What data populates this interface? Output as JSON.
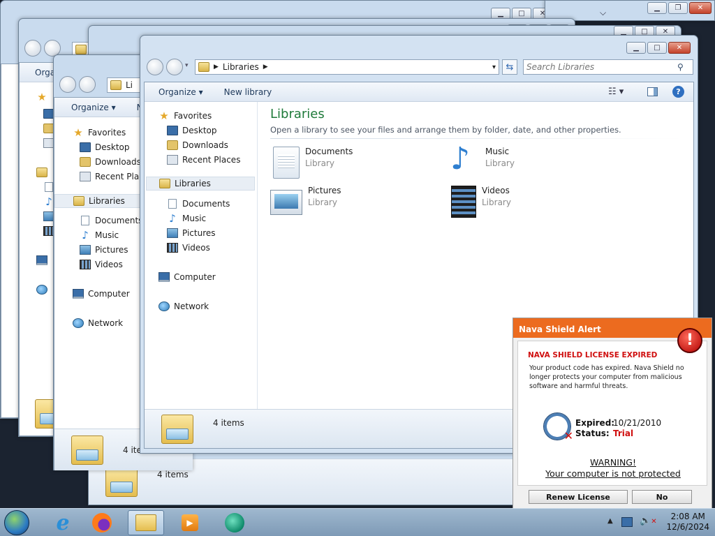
{
  "colors": {
    "accent_green": "#1f7a3a",
    "alert_orange": "#ec6b1f",
    "alert_red": "#d01010"
  },
  "explorer": {
    "breadcrumb": "Libraries",
    "search_placeholder": "Search Libraries",
    "toolbar": {
      "organize": "Organize ▾",
      "new_library": "New library"
    },
    "nav": {
      "favorites": "Favorites",
      "desktop": "Desktop",
      "downloads": "Downloads",
      "recent_places": "Recent Places",
      "libraries": "Libraries",
      "documents": "Documents",
      "music": "Music",
      "pictures": "Pictures",
      "videos": "Videos",
      "computer": "Computer",
      "network": "Network"
    },
    "main": {
      "title": "Libraries",
      "subtitle": "Open a library to see your files and arrange them by folder, date, and other properties.",
      "tiles": [
        {
          "name": "Documents",
          "type": "Library",
          "icon": "documents-library-icon"
        },
        {
          "name": "Music",
          "type": "Library",
          "icon": "music-library-icon"
        },
        {
          "name": "Pictures",
          "type": "Library",
          "icon": "pictures-library-icon"
        },
        {
          "name": "Videos",
          "type": "Library",
          "icon": "videos-library-icon"
        }
      ]
    },
    "status": "4 items",
    "back_window": {
      "breadcrumb_short": "Li",
      "organize_short": "N",
      "recent_short": "Recent Place"
    }
  },
  "alert": {
    "title": "Nava Shield Alert",
    "headline": "NAVA SHIELD LICENSE EXPIRED",
    "message": "Your product code has expired. Nava Shield no longer protects your computer from malicious software and harmful threats.",
    "expired_label": "Expired:",
    "expired_value": "10/21/2010",
    "status_label": "Status:",
    "status_value": "Trial",
    "warning": "WARNING!",
    "warning_sub": "Your computer is not protected",
    "renew_button": "Renew License",
    "no_button": "No"
  },
  "taskbar": {
    "time": "2:08 AM",
    "date": "12/6/2024"
  }
}
